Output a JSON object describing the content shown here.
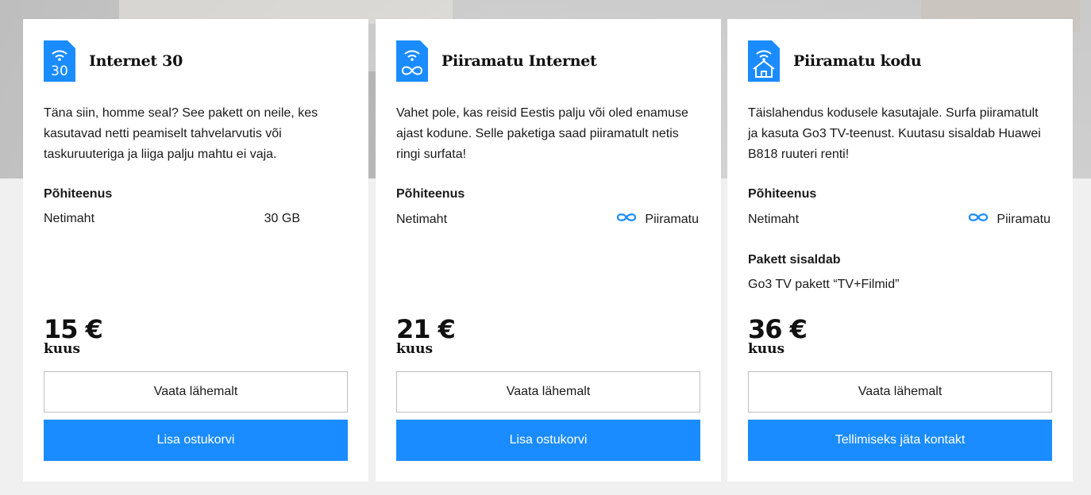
{
  "theme": {
    "accent": "#1a8cff",
    "text": "#1a1a1a",
    "card_bg": "#ffffff",
    "page_bg": "#f0f0f0"
  },
  "cards": [
    {
      "icon": "sim-30-icon",
      "icon_text": "30",
      "title": "Internet 30",
      "description": "Täna siin, homme seal? See pakett on neile, kes kasutavad netti peamiselt tahvelarvutis või taskuruuteriga ja liiga palju mahtu ei vaja.",
      "base_service_title": "Põhiteenus",
      "data_label": "Netimaht",
      "data_value": "30 GB",
      "price": "15 €",
      "period": "kuus",
      "details_button": "Vaata lähemalt",
      "cta_button": "Lisa ostukorvi"
    },
    {
      "icon": "sim-infinity-icon",
      "title": "Piiramatu Internet",
      "description": "Vahet pole, kas reisid Eestis palju või oled enamuse ajast kodune. Selle paketiga saad piiramatult netis ringi surfata!",
      "base_service_title": "Põhiteenus",
      "data_label": "Netimaht",
      "data_value": "Piiramatu",
      "data_value_icon": "infinity-icon",
      "price": "21 €",
      "period": "kuus",
      "details_button": "Vaata lähemalt",
      "cta_button": "Lisa ostukorvi"
    },
    {
      "icon": "sim-home-icon",
      "title": "Piiramatu kodu",
      "description": "Täislahendus kodusele kasutajale. Surfa piiramatult ja kasuta Go3 TV-teenust. Kuutasu sisaldab Huawei B818 ruuteri renti!",
      "base_service_title": "Põhiteenus",
      "data_label": "Netimaht",
      "data_value": "Piiramatu",
      "data_value_icon": "infinity-icon",
      "includes_title": "Pakett sisaldab",
      "includes_value": "Go3 TV pakett “TV+Filmid”",
      "price": "36 €",
      "period": "kuus",
      "details_button": "Vaata lähemalt",
      "cta_button": "Tellimiseks jäta kontakt"
    }
  ]
}
